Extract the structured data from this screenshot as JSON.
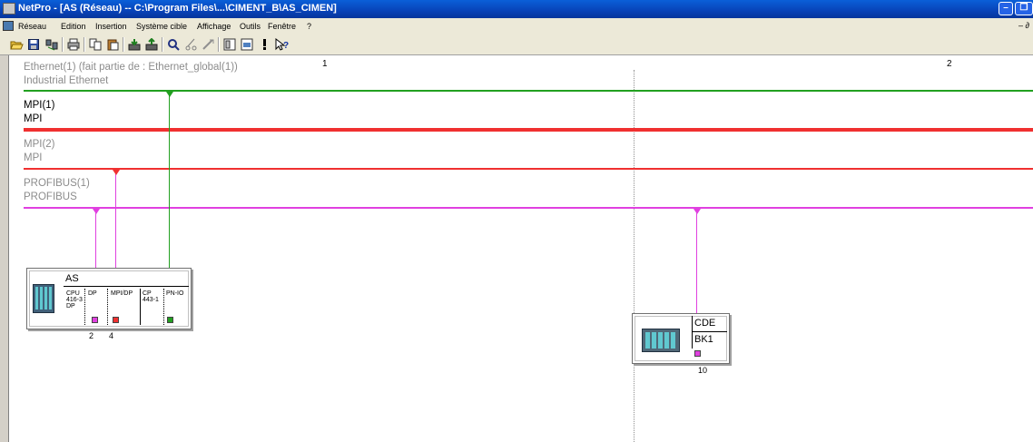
{
  "window": {
    "title": "NetPro - [AS (Réseau) -- C:\\Program Files\\...\\CIMENT_B\\AS_CIMEN]",
    "min_glyph": "–",
    "restore_glyph": "❐"
  },
  "menubar": {
    "items": [
      "Réseau",
      "Edition",
      "Insertion",
      "Système cible",
      "Affichage",
      "Outils",
      "Fenêtre",
      "?"
    ],
    "mdi_controls": "– ∂"
  },
  "toolbar": {
    "buttons": [
      "open-icon",
      "save-icon",
      "network-icon",
      "print-icon",
      "copy-icon",
      "paste-icon",
      "download-icon",
      "upload-icon",
      "diagnostic-icon",
      "cut-icon",
      "paste2-icon",
      "config-icon",
      "station-icon",
      "error-icon",
      "help-icon"
    ]
  },
  "workspace": {
    "column_1": "1",
    "column_2": "2",
    "networks": [
      {
        "name": "Ethernet(1) (fait partie de : Ethernet_global(1))",
        "type": "Industrial Ethernet",
        "color": "#22a020",
        "active": false
      },
      {
        "name": "MPI(1)",
        "type": "MPI",
        "color": "#f03030",
        "active": true
      },
      {
        "name": "MPI(2)",
        "type": "MPI",
        "color": "#f03030",
        "active": false
      },
      {
        "name": "PROFIBUS(1)",
        "type": "PROFIBUS",
        "color": "#e040e0",
        "active": false
      }
    ]
  },
  "station_as": {
    "name": "AS",
    "modules": [
      {
        "label": "CPU\n416-3\nDP"
      },
      {
        "label": "DP"
      },
      {
        "label": "MPI/DP"
      },
      {
        "label": "CP\n443-1"
      },
      {
        "label": "PN-IO"
      }
    ],
    "slot_numbers": [
      "2",
      "4"
    ]
  },
  "station_cde": {
    "name_line1": "CDE",
    "name_line2": "BK1",
    "address": "10"
  },
  "colors": {
    "ethernet": "#22a020",
    "mpi": "#f03030",
    "profibus": "#e040e0",
    "titlebar": "#0843b8"
  }
}
